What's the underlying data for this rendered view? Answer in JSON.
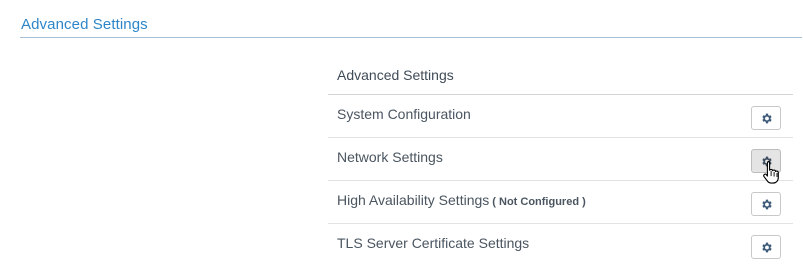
{
  "section": {
    "title": "Advanced Settings",
    "accent_color": "#2e86c9"
  },
  "table": {
    "heading": "Advanced Settings",
    "rows": [
      {
        "label": "System Configuration",
        "note": "",
        "button_icon": "gear-icon"
      },
      {
        "label": "Network Settings",
        "note": "",
        "button_icon": "gear-icon",
        "hovered": true
      },
      {
        "label": "High Availability Settings",
        "note": "( Not Configured )",
        "button_icon": "gear-icon"
      },
      {
        "label": "TLS Server Certificate Settings",
        "note": "",
        "button_icon": "gear-icon"
      }
    ]
  },
  "cursor": "hand-pointer-icon"
}
